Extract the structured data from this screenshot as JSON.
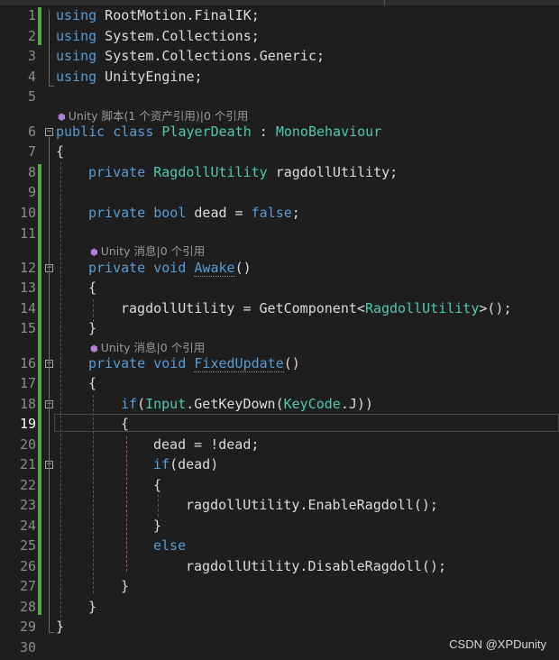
{
  "editor": {
    "line_numbers": [
      "1",
      "2",
      "3",
      "4",
      "5",
      "6",
      "7",
      "8",
      "9",
      "10",
      "11",
      "12",
      "13",
      "14",
      "15",
      "16",
      "17",
      "18",
      "19",
      "20",
      "21",
      "22",
      "23",
      "24",
      "25",
      "26",
      "27",
      "28",
      "29",
      "30"
    ],
    "current_line": "19",
    "codelens": {
      "class": "Unity 脚本(1 个资产引用)|0 个引用",
      "awake": "Unity 消息|0 个引用",
      "fixed_update": "Unity 消息|0 个引用"
    },
    "code": {
      "l1": {
        "kw": "using",
        "rest": " RootMotion.FinalIK;"
      },
      "l2": {
        "kw": "using",
        "rest": " System.Collections;"
      },
      "l3": {
        "kw": "using",
        "rest": " System.Collections.Generic;"
      },
      "l4": {
        "kw": "using",
        "rest": " UnityEngine;"
      },
      "l6": {
        "kw1": "public",
        "kw2": " class ",
        "name": "PlayerDeath",
        "colon": " : ",
        "base": "MonoBehaviour"
      },
      "l7": "{",
      "l8": {
        "kw": "private ",
        "type": "RagdollUtility",
        "rest": " ragdollUtility;"
      },
      "l10": {
        "kw": "private ",
        "type": "bool",
        "rest": " dead = ",
        "val": "false",
        "end": ";"
      },
      "l12": {
        "kw": "private ",
        "type": "void ",
        "name": "Awake",
        "rest": "()"
      },
      "l13": "{",
      "l14": {
        "pre": "ragdollUtility = GetComponent<",
        "type": "RagdollUtility",
        "post": ">();"
      },
      "l15": "}",
      "l16": {
        "kw": "private ",
        "type": "void ",
        "name": "FixedUpdate",
        "rest": "()"
      },
      "l17": "{",
      "l18": {
        "kw": "if",
        "p1": "(",
        "c1": "Input",
        "p2": ".GetKeyDown(",
        "c2": "KeyCode",
        "p3": ".J))"
      },
      "l19": "{",
      "l20": "dead = !dead;",
      "l21": {
        "kw": "if",
        "rest": "(dead)"
      },
      "l22": "{",
      "l23": "ragdollUtility.EnableRagdoll();",
      "l24": "}",
      "l25": "else",
      "l26": "ragdollUtility.DisableRagdoll();",
      "l27": "}",
      "l28": "}",
      "l29": "}"
    }
  },
  "watermark": "CSDN @XPDunity"
}
